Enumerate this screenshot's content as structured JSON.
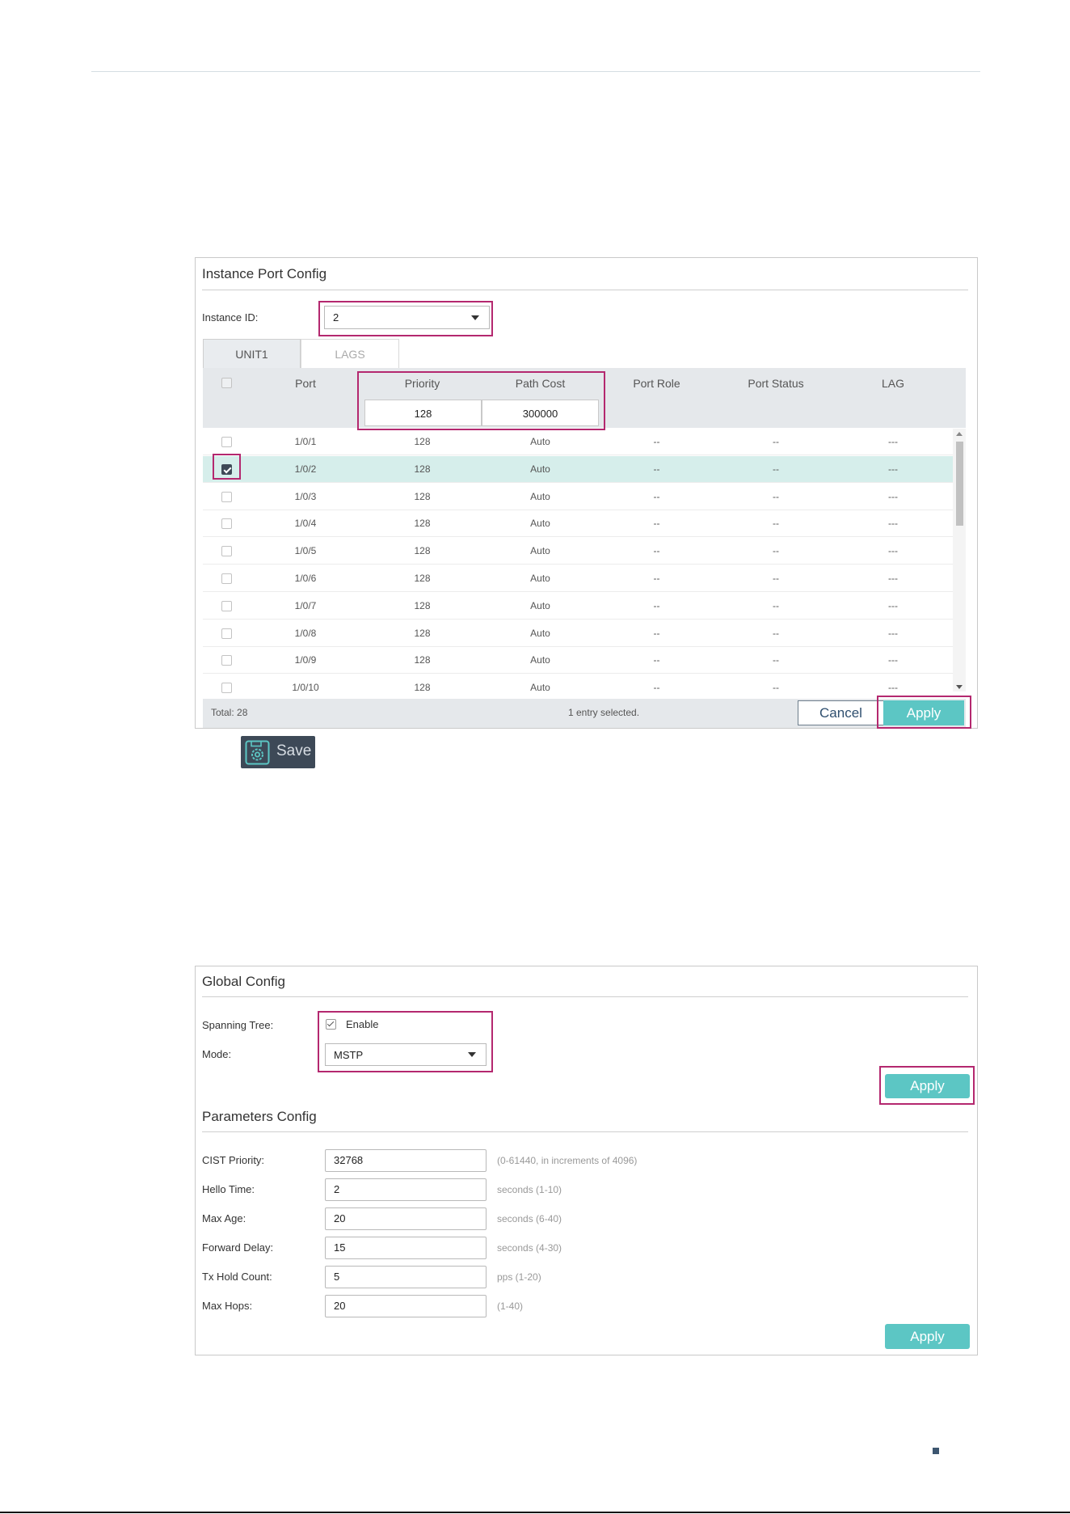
{
  "colors": {
    "accent": "#5cc6c4",
    "highlight": "#b4286f",
    "selected_row": "#d6eeeb",
    "header_bg": "#e5e8eb"
  },
  "instance_panel": {
    "title": "Instance Port Config",
    "instance_id_label": "Instance ID:",
    "instance_id_value": "2",
    "tabs": [
      {
        "label": "UNIT1",
        "active": true
      },
      {
        "label": "LAGS",
        "active": false
      }
    ],
    "columns": [
      "Port",
      "Priority",
      "Path Cost",
      "Port Role",
      "Port Status",
      "LAG"
    ],
    "filter": {
      "priority": "128",
      "path_cost": "300000"
    },
    "rows": [
      {
        "port": "1/0/1",
        "priority": "128",
        "path_cost": "Auto",
        "role": "--",
        "status": "--",
        "lag": "---",
        "checked": false
      },
      {
        "port": "1/0/2",
        "priority": "128",
        "path_cost": "Auto",
        "role": "--",
        "status": "--",
        "lag": "---",
        "checked": true
      },
      {
        "port": "1/0/3",
        "priority": "128",
        "path_cost": "Auto",
        "role": "--",
        "status": "--",
        "lag": "---",
        "checked": false
      },
      {
        "port": "1/0/4",
        "priority": "128",
        "path_cost": "Auto",
        "role": "--",
        "status": "--",
        "lag": "---",
        "checked": false
      },
      {
        "port": "1/0/5",
        "priority": "128",
        "path_cost": "Auto",
        "role": "--",
        "status": "--",
        "lag": "---",
        "checked": false
      },
      {
        "port": "1/0/6",
        "priority": "128",
        "path_cost": "Auto",
        "role": "--",
        "status": "--",
        "lag": "---",
        "checked": false
      },
      {
        "port": "1/0/7",
        "priority": "128",
        "path_cost": "Auto",
        "role": "--",
        "status": "--",
        "lag": "---",
        "checked": false
      },
      {
        "port": "1/0/8",
        "priority": "128",
        "path_cost": "Auto",
        "role": "--",
        "status": "--",
        "lag": "---",
        "checked": false
      },
      {
        "port": "1/0/9",
        "priority": "128",
        "path_cost": "Auto",
        "role": "--",
        "status": "--",
        "lag": "---",
        "checked": false
      },
      {
        "port": "1/0/10",
        "priority": "128",
        "path_cost": "Auto",
        "role": "--",
        "status": "--",
        "lag": "---",
        "checked": false
      }
    ],
    "total": "Total: 28",
    "selection_text": "1 entry selected.",
    "cancel_label": "Cancel",
    "apply_label": "Apply"
  },
  "save": {
    "label": "Save",
    "icon": "save-gear-icon"
  },
  "global_panel": {
    "title": "Global Config",
    "spanning_tree_label": "Spanning Tree:",
    "enable_label": "Enable",
    "enable_checked": true,
    "mode_label": "Mode:",
    "mode_value": "MSTP",
    "apply_label": "Apply",
    "params_title": "Parameters Config",
    "params": [
      {
        "label": "CIST Priority:",
        "value": "32768",
        "hint": "(0-61440, in increments of 4096)"
      },
      {
        "label": "Hello Time:",
        "value": "2",
        "hint": "seconds (1-10)"
      },
      {
        "label": "Max Age:",
        "value": "20",
        "hint": "seconds (6-40)"
      },
      {
        "label": "Forward Delay:",
        "value": "15",
        "hint": "seconds (4-30)"
      },
      {
        "label": "Tx Hold Count:",
        "value": "5",
        "hint": "pps (1-20)"
      },
      {
        "label": "Max Hops:",
        "value": "20",
        "hint": "(1-40)"
      }
    ],
    "params_apply_label": "Apply"
  }
}
